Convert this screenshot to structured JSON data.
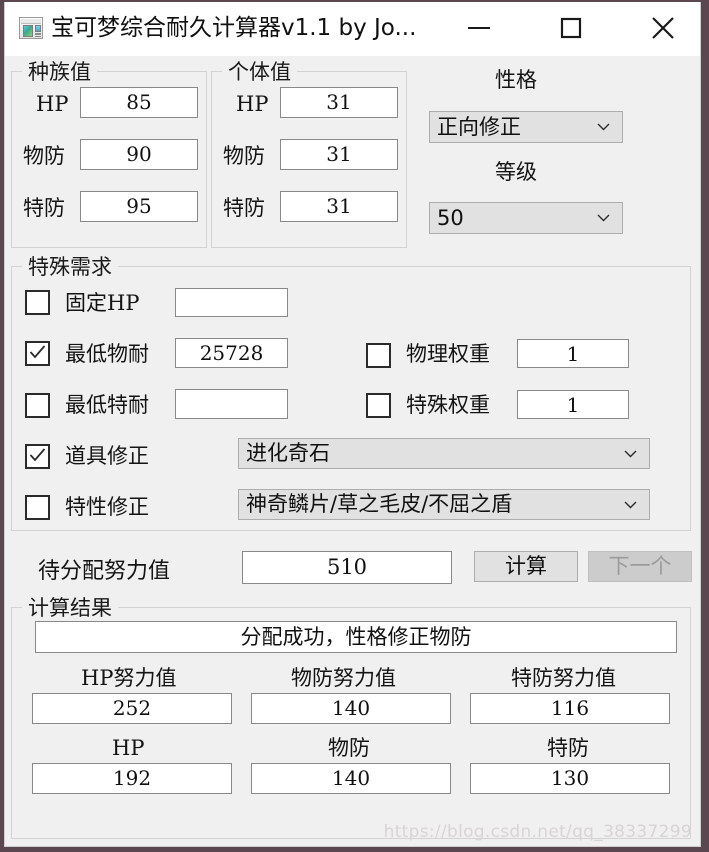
{
  "window": {
    "title": "宝可梦综合耐久计算器v1.1 by Jo...",
    "icon": "app-window-icon",
    "controls": {
      "minimize": "minimize-icon",
      "maximize": "maximize-icon",
      "close": "close-icon"
    }
  },
  "base_stats": {
    "group_title": "种族值",
    "rows": [
      {
        "label": "HP",
        "value": "85"
      },
      {
        "label": "物防",
        "value": "90"
      },
      {
        "label": "特防",
        "value": "95"
      }
    ]
  },
  "ivs": {
    "group_title": "个体值",
    "rows": [
      {
        "label": "HP",
        "value": "31"
      },
      {
        "label": "物防",
        "value": "31"
      },
      {
        "label": "特防",
        "value": "31"
      }
    ]
  },
  "nature": {
    "label": "性格",
    "value": "正向修正"
  },
  "level": {
    "label": "等级",
    "value": "50"
  },
  "special_requirements": {
    "group_title": "特殊需求",
    "fixed_hp": {
      "label": "固定HP",
      "checked": false,
      "value": ""
    },
    "min_phys_bulk": {
      "label": "最低物耐",
      "checked": true,
      "value": "25728"
    },
    "min_spec_bulk": {
      "label": "最低特耐",
      "checked": false,
      "value": ""
    },
    "phys_weight": {
      "label": "物理权重",
      "checked": false,
      "value": "1"
    },
    "spec_weight": {
      "label": "特殊权重",
      "checked": false,
      "value": "1"
    },
    "item_mod": {
      "label": "道具修正",
      "checked": true,
      "value": "进化奇石"
    },
    "ability_mod": {
      "label": "特性修正",
      "checked": false,
      "value": "神奇鳞片/草之毛皮/不屈之盾"
    }
  },
  "allocation": {
    "label": "待分配努力值",
    "value": "510",
    "calculate_button": "计算",
    "next_button": "下一个"
  },
  "results": {
    "group_title": "计算结果",
    "status": "分配成功，性格修正物防",
    "ev_row": [
      {
        "label": "HP努力值",
        "value": "252"
      },
      {
        "label": "物防努力值",
        "value": "140"
      },
      {
        "label": "特防努力值",
        "value": "116"
      }
    ],
    "stat_row": [
      {
        "label": "HP",
        "value": "192"
      },
      {
        "label": "物防",
        "value": "140"
      },
      {
        "label": "特防",
        "value": "130"
      }
    ]
  },
  "watermark": "https://blog.csdn.net/qq_38337299",
  "colors": {
    "window_bg": "#f0f0f0",
    "titlebar_bg": "#ffffff",
    "field_bg": "#ffffff",
    "control_bg": "#e1e1e1",
    "disabled_bg": "#cccccc",
    "border": "#d3d3d3",
    "text": "#141414"
  }
}
